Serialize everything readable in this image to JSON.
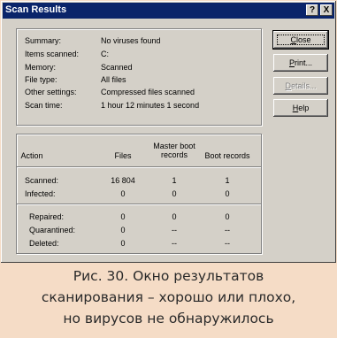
{
  "window": {
    "title": "Scan Results",
    "help_button": "?",
    "close_button": "X"
  },
  "summary": [
    {
      "label": "Summary:",
      "value": "No viruses found"
    },
    {
      "label": "Items scanned:",
      "value": "C:"
    },
    {
      "label": "Memory:",
      "value": "Scanned"
    },
    {
      "label": "File type:",
      "value": "All files"
    },
    {
      "label": "Other settings:",
      "value": "Compressed files scanned"
    },
    {
      "label": "Scan time:",
      "value": "1 hour 12 minutes 1 second"
    }
  ],
  "results": {
    "headers": {
      "action": "Action",
      "files": "Files",
      "mbr_line1": "Master boot",
      "mbr_line2": "records",
      "boot": "Boot records"
    },
    "rows": [
      {
        "label": "Scanned:",
        "files": "16 804",
        "mbr": "1",
        "boot": "1"
      },
      {
        "label": "Infected:",
        "files": "0",
        "mbr": "0",
        "boot": "0"
      },
      {
        "label": "Repaired:",
        "files": "0",
        "mbr": "0",
        "boot": "0"
      },
      {
        "label": "Quarantined:",
        "files": "0",
        "mbr": "--",
        "boot": "--"
      },
      {
        "label": "Deleted:",
        "files": "0",
        "mbr": "--",
        "boot": "--"
      }
    ]
  },
  "buttons": {
    "close": {
      "pre": "",
      "u": "C",
      "post": "lose"
    },
    "print": {
      "pre": "",
      "u": "P",
      "post": "rint..."
    },
    "details": {
      "pre": "",
      "u": "D",
      "post": "etails..."
    },
    "help": {
      "pre": "",
      "u": "H",
      "post": "elp"
    }
  },
  "caption": {
    "line1": "Рис. 30. Окно результатов",
    "line2": "сканирования – хорошо или плохо,",
    "line3": "но вирусов не обнаружилось"
  }
}
